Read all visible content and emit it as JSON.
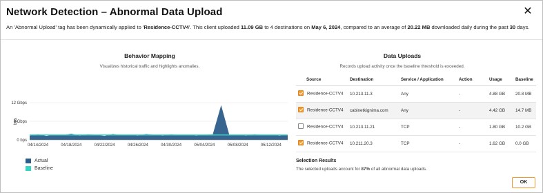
{
  "dialog": {
    "title": "Network Detection – Abnormal Data Upload",
    "close_glyph": "✕",
    "summary": {
      "p1": "An 'Abnormal Upload' tag has been dynamically applied to '",
      "client": "Residence-CCTV4",
      "p2": "'. This client uploaded ",
      "uploaded": "11.09 GB",
      "p3": " to 4 destinations on ",
      "date": "May 6, 2024",
      "p4": ", compared to an average of ",
      "average": "20.22 MB",
      "p5": " downloaded daily during the past ",
      "days": "30",
      "p6": " days."
    }
  },
  "behavior": {
    "title": "Behavior Mapping",
    "subtitle": "Visualizes historical traffic and highlights anomalies."
  },
  "chart_data": {
    "type": "area",
    "title": "",
    "xlabel": "",
    "ylabel": "bps",
    "y_ticks": [
      "12 Gbps",
      "6 Gbps",
      "0 bps"
    ],
    "ylim": [
      0,
      12
    ],
    "y_unit": "Gbps",
    "x_ticks": [
      "04/14/2024",
      "04/18/2024",
      "04/22/2024",
      "04/26/2024",
      "04/30/2024",
      "05/04/2024",
      "05/08/2024",
      "05/12/2024"
    ],
    "x_start": "2024-04-13",
    "x_end": "2024-05-14",
    "grid": true,
    "legend_position": "bottom-left",
    "series": [
      {
        "name": "Actual",
        "color": "#2c5d8a",
        "points": [
          [
            "2024-04-13",
            1.4
          ],
          [
            "2024-04-14",
            1.8
          ],
          [
            "2024-04-15",
            1.3
          ],
          [
            "2024-04-16",
            1.7
          ],
          [
            "2024-04-17",
            1.5
          ],
          [
            "2024-04-18",
            2.0
          ],
          [
            "2024-04-19",
            1.4
          ],
          [
            "2024-04-20",
            1.8
          ],
          [
            "2024-04-21",
            1.6
          ],
          [
            "2024-04-22",
            1.3
          ],
          [
            "2024-04-23",
            1.9
          ],
          [
            "2024-04-24",
            1.5
          ],
          [
            "2024-04-25",
            1.7
          ],
          [
            "2024-04-26",
            1.4
          ],
          [
            "2024-04-27",
            1.9
          ],
          [
            "2024-04-28",
            1.6
          ],
          [
            "2024-04-29",
            1.4
          ],
          [
            "2024-04-30",
            1.8
          ],
          [
            "2024-05-01",
            1.5
          ],
          [
            "2024-05-02",
            1.7
          ],
          [
            "2024-05-03",
            1.4
          ],
          [
            "2024-05-04",
            1.6
          ],
          [
            "2024-05-05",
            1.8
          ],
          [
            "2024-05-06",
            11.2
          ],
          [
            "2024-05-07",
            1.5
          ],
          [
            "2024-05-08",
            1.7
          ],
          [
            "2024-05-09",
            1.4
          ],
          [
            "2024-05-10",
            1.8
          ],
          [
            "2024-05-11",
            1.5
          ],
          [
            "2024-05-12",
            1.7
          ],
          [
            "2024-05-13",
            1.4
          ],
          [
            "2024-05-14",
            1.6
          ]
        ]
      },
      {
        "name": "Baseline",
        "color": "#33d6c3",
        "points": [
          [
            "2024-04-13",
            1.6
          ],
          [
            "2024-04-14",
            1.6
          ],
          [
            "2024-04-15",
            1.6
          ],
          [
            "2024-04-16",
            1.6
          ],
          [
            "2024-04-17",
            1.6
          ],
          [
            "2024-04-18",
            1.6
          ],
          [
            "2024-04-19",
            1.6
          ],
          [
            "2024-04-20",
            1.6
          ],
          [
            "2024-04-21",
            1.6
          ],
          [
            "2024-04-22",
            1.6
          ],
          [
            "2024-04-23",
            1.6
          ],
          [
            "2024-04-24",
            1.6
          ],
          [
            "2024-04-25",
            1.6
          ],
          [
            "2024-04-26",
            1.6
          ],
          [
            "2024-04-27",
            1.6
          ],
          [
            "2024-04-28",
            1.6
          ],
          [
            "2024-04-29",
            1.6
          ],
          [
            "2024-04-30",
            1.6
          ],
          [
            "2024-05-01",
            1.6
          ],
          [
            "2024-05-02",
            1.6
          ],
          [
            "2024-05-03",
            1.6
          ],
          [
            "2024-05-04",
            1.6
          ],
          [
            "2024-05-05",
            1.6
          ],
          [
            "2024-05-06",
            1.6
          ],
          [
            "2024-05-07",
            1.6
          ],
          [
            "2024-05-08",
            1.6
          ],
          [
            "2024-05-09",
            1.6
          ],
          [
            "2024-05-10",
            1.6
          ],
          [
            "2024-05-11",
            1.6
          ],
          [
            "2024-05-12",
            1.6
          ],
          [
            "2024-05-13",
            1.6
          ],
          [
            "2024-05-14",
            1.6
          ]
        ]
      }
    ]
  },
  "uploads": {
    "title": "Data Uploads",
    "subtitle": "Records upload activity once the baseline threshold is exceeded.",
    "columns": [
      "Source",
      "Destination",
      "Service / Application",
      "Action",
      "Usage",
      "Baseline"
    ],
    "rows": [
      {
        "checked": true,
        "source": "Residence-CCTV4",
        "destination": "10.213.11.3",
        "service": "Any",
        "action": "-",
        "usage": "4.88 GB",
        "baseline": "20.8 MB"
      },
      {
        "checked": true,
        "source": "Residence-CCTV4",
        "destination": "cabinetkignima.com",
        "service": "Any",
        "action": "-",
        "usage": "4.42 GB",
        "baseline": "14.7 MB"
      },
      {
        "checked": false,
        "source": "Residence-CCTV4",
        "destination": "10.213.11.21",
        "service": "TCP",
        "action": "-",
        "usage": "1.80 GB",
        "baseline": "10.2 GB"
      },
      {
        "checked": true,
        "source": "Residence-CCTV4",
        "destination": "10.211.20.3",
        "service": "TCP",
        "action": "-",
        "usage": "1.62 GB",
        "baseline": "0.0 GB"
      }
    ]
  },
  "selection": {
    "title": "Selection Results",
    "p1": "The selected uploads account for ",
    "percent": "87%",
    "p2": " of all abnormal data uploads."
  },
  "footer": {
    "ok_label": "OK"
  },
  "colors": {
    "accent": "#f29a2e",
    "actual": "#2c5d8a",
    "baseline": "#33d6c3"
  }
}
